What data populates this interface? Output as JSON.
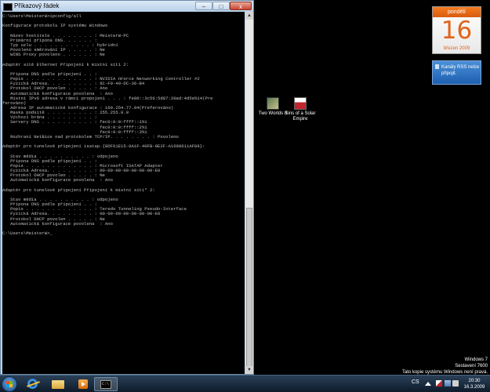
{
  "window": {
    "title": "Příkazový řádek",
    "buttons": {
      "minimize": "–",
      "maximize": "□",
      "close": "x"
    },
    "console_lines": [
      "C:\\Users\\MeisterW>ipconfig/all",
      "",
      "Konfigurace protokolu IP systému Windows",
      "",
      "   Název hostitele . . . . . . . . : MeisterW-PC",
      "   Primární přípona DNS. . . . . . : ",
      "   Typ uzlu . . . . . . . . . . . : hybridní",
      "   Povoleno směrování IP . . . . . : Ne",
      "   WINS Proxy povoleno . . . . . . : Ne",
      "",
      "Adaptér sítě Ethernet Připojení k místní síti 2:",
      "",
      "   Přípona DNS podle připojení . . : ",
      "   Popis . . . . . . . . . . . . . : NVIDIA nForce Networking Controller #2",
      "   Fyzická Adresa. . . . . . . . . : 6C-F0-49-DC-36-B4",
      "   Protokol DHCP povolen . . . . . : Ano",
      "   Automatická konfigurace povolena  : Ano",
      "   Místní IPv6 adresa v rámci propojení . . . : fe80::3c56:5d87:20ad:4d5e%14(Pre",
      "ferováno)",
      "   Adresa IP automatické konfigurace : 169.254.77.94(Preferováno)",
      "   Maska podsítě . . . . . . . . . : 255.255.0.0",
      "   Výchozí brána . . . . . . . . . : ",
      "   Servery DNS . . . . . . . . . . : fec0:0:0:ffff::1%1",
      "                                     fec0:0:0:ffff::2%1",
      "                                     fec0:0:0:ffff::3%1",
      "   Rozhraní NetBios nad protokolem TCP/IP. . . . . . . . : Povoleno",
      "",
      "Adaptér pro tunelové připojení isatap.{8DF61E15-0A1F-40FB-8E2F-A1698611AF08}:",
      "",
      "   Stav média . . . . . . . . . . : odpojeno",
      "   Přípona DNS podle připojení . . : ",
      "   Popis . . . . . . . . . . . . . : Microsoft ISATAP Adapter",
      "   Fyzická Adresa. . . . . . . . . : 00-00-00-00-00-00-00-E0",
      "   Protokol DHCP povolen . . . . . : Ne",
      "   Automatická konfigurace povolena  : Ano",
      "",
      "Adaptér pro tunelové připojení Připojení k místní síti* 2:",
      "",
      "   Stav média . . . . . . . . . . : odpojeno",
      "   Přípona DNS podle připojení . . : ",
      "   Popis . . . . . . . . . . . . . : Teredo Tunneling Pseudo-Interface",
      "   Fyzická Adresa. . . . . . . . . : 00-00-00-00-00-00-00-E0",
      "   Protokol DHCP povolen . . . . . : Ne",
      "   Automatická konfigurace povolena  : Ano",
      "",
      "C:\\Users\\MeisterW>_"
    ]
  },
  "gadgets": {
    "calendar": {
      "weekday": "pondělí",
      "day": "16",
      "month_year": "březen 2009"
    },
    "feed": {
      "text": "Kanály RSS nelze připojit."
    }
  },
  "desktop_icons": [
    {
      "label": "Two Worlds II"
    },
    {
      "label": "Sins of a Solar Empire"
    }
  ],
  "watermark": {
    "line1": "Windows 7",
    "line2": "Sestavení 7600",
    "line3": "Tato kopie systému Windows není pravá."
  },
  "taskbar": {
    "language": "CS",
    "time": "20:30",
    "date": "16.3.2009",
    "cmd_glyph": "C:\\"
  }
}
